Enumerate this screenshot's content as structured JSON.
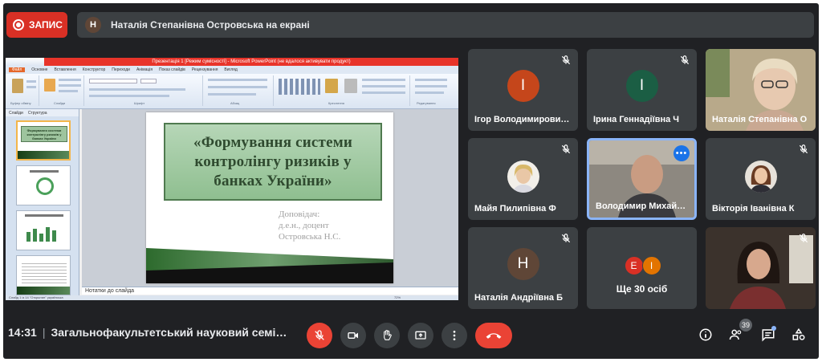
{
  "recording": {
    "label": "ЗАПИС"
  },
  "presenting": {
    "initial": "Н",
    "text": "Наталія Степанівна Островська на екрані"
  },
  "presentation": {
    "window_title": "Презентація 1 [Режим сумісності] - Microsoft PowerPoint (не вдалося активувати продукт)",
    "tabs": [
      "Файл",
      "Основне",
      "Вставлення",
      "Конструктор",
      "Переходи",
      "Анімація",
      "Показ слайдів",
      "Рецензування",
      "Вигляд"
    ],
    "groups": [
      "Буфер обміну",
      "Слайди",
      "Шрифт",
      "Абзац",
      "Креслення",
      "Редагування"
    ],
    "panel_tabs": [
      "Слайди",
      "Структура"
    ],
    "thumbnails": [
      {
        "num": "1",
        "text": "Формування системи контролінгу ризиків у банках України"
      },
      {
        "num": "2",
        "text": ""
      },
      {
        "num": "3",
        "text": ""
      },
      {
        "num": "4",
        "text": ""
      }
    ],
    "slide_title": "«Формування системи контролінгу ризиків у банках України»",
    "slide_author_lines": [
      "Доповідач:",
      "д.е.н., доцент",
      "Островська Н.С."
    ],
    "notes_placeholder": "Нотатки до слайда",
    "status": "Слайд 1 із 14   \"Открытие\"   українська",
    "zoom": "72%"
  },
  "participants": [
    {
      "name": "Ігор Володимирович Ш",
      "initial": "І",
      "color": "#c5461b",
      "muted": true
    },
    {
      "name": "Ірина Геннадіївна Ч",
      "initial": "І",
      "color": "#1b5e44",
      "muted": true
    },
    {
      "name": "Наталія Степанівна О",
      "photo": "woman-glasses",
      "muted": false
    },
    {
      "name": "Майя Пилипівна Ф",
      "photo": "woman-blonde",
      "muted": true
    },
    {
      "name": "Володимир Михайлович",
      "photo": "man-bald",
      "muted": false,
      "active": true
    },
    {
      "name": "Вікторія Іванівна К",
      "photo": "woman-dark",
      "muted": true
    },
    {
      "name": "Наталія Андріївна Б",
      "initial": "Н",
      "color": "#5f4637",
      "muted": true
    },
    {
      "name": "Ще 30 осіб",
      "others": [
        {
          "initial": "Е",
          "color": "#d93025"
        },
        {
          "initial": "І",
          "color": "#e37400"
        }
      ]
    },
    {
      "name": "",
      "photo": "woman-brunette",
      "muted": true
    }
  ],
  "bottom": {
    "time": "14:31",
    "separator": "|",
    "meeting_name": "Загальнофакультетський науковий семі…",
    "participant_count": "39"
  },
  "colors": {
    "background": "#202124",
    "tile": "#3c4043",
    "danger": "#ea4335",
    "accent": "#8ab4f8"
  },
  "icons": [
    "mic-off-icon",
    "videocam-icon",
    "raise-hand-icon",
    "present-icon",
    "more-vert-icon",
    "end-call-icon",
    "info-icon",
    "people-icon",
    "chat-icon",
    "activities-icon"
  ]
}
